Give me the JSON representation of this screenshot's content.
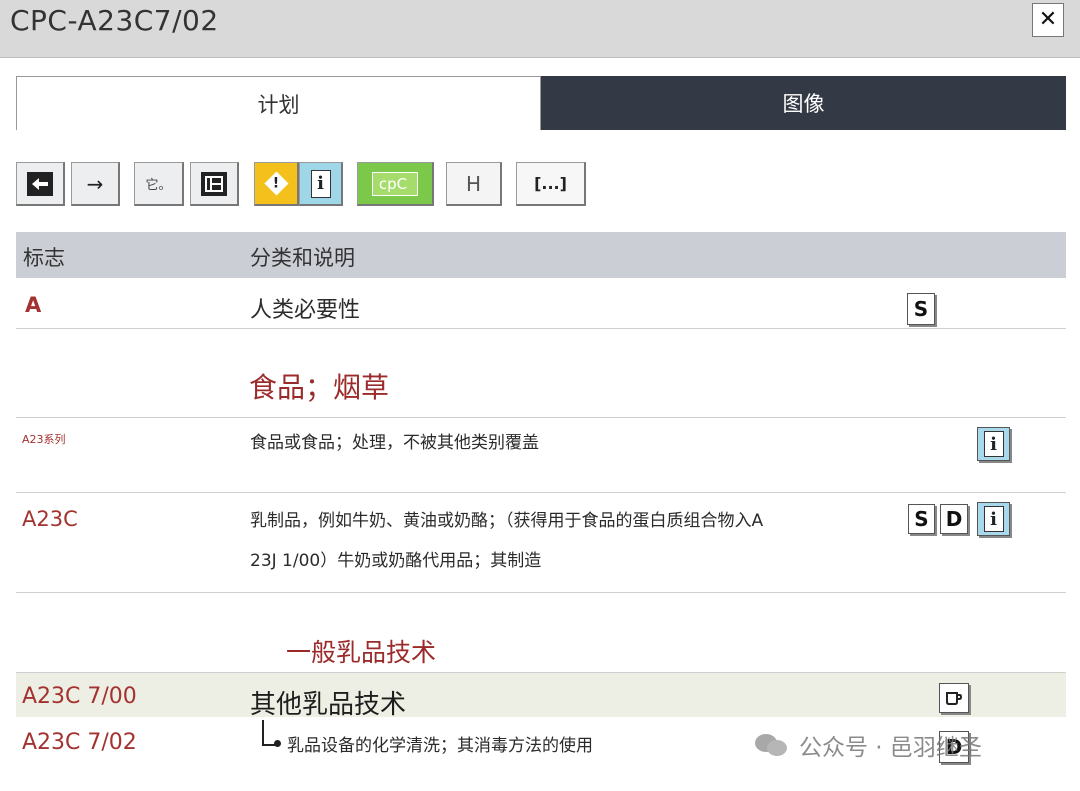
{
  "window": {
    "title": "CPC-A23C7/02"
  },
  "tabs": [
    {
      "label": "计划",
      "active": true
    },
    {
      "label": "图像",
      "active": false
    }
  ],
  "toolbar": {
    "buttons": [
      {
        "name": "back",
        "icon": "arrow-left-icon",
        "glyph": "🡰"
      },
      {
        "name": "forward",
        "icon": "arrow-right-icon",
        "glyph": "→"
      },
      {
        "name": "notes",
        "icon": "notes-icon",
        "label": "它。"
      },
      {
        "name": "tree",
        "icon": "hierarchy-icon",
        "glyph": "⊟"
      },
      {
        "name": "warning",
        "icon": "warning-icon",
        "glyph": "!"
      },
      {
        "name": "info",
        "icon": "info-icon",
        "glyph": "i"
      },
      {
        "name": "cpc",
        "label": "cpC"
      },
      {
        "name": "h",
        "label": "H"
      },
      {
        "name": "more",
        "label": "[...]"
      }
    ],
    "colors": {
      "warning": "#f3c01c",
      "info": "#9fd6e8",
      "cpc": "#7bc84a"
    }
  },
  "table": {
    "headers": {
      "symbol": "标志",
      "description": "分类和说明"
    },
    "rows": [
      {
        "code": "A",
        "text": "人类必要性",
        "icons": [
          "S"
        ]
      },
      {
        "heading": "食品；烟草"
      },
      {
        "code": "A23系列",
        "text": "食品或食品；处理，不被其他类别覆盖",
        "icons": [
          "i"
        ]
      },
      {
        "code": "A23C",
        "text_line1": "乳制品，例如牛奶、黄油或奶酪；（获得用于食品的蛋白质组合物入A",
        "text_line2": "23J 1/00）牛奶或奶酪代用品；其制造",
        "icons": [
          "S",
          "D",
          "i"
        ]
      },
      {
        "heading": "一般乳品技术"
      },
      {
        "code": "A23C 7/00",
        "text": "其他乳品技术",
        "icons": [
          "cup"
        ]
      },
      {
        "code": "A23C 7/02",
        "text": "乳品设备的化学清洗；其消毒方法的使用",
        "icons": [
          "D"
        ]
      }
    ]
  },
  "watermark": {
    "text": "公众号 · 邑羽继圣"
  }
}
